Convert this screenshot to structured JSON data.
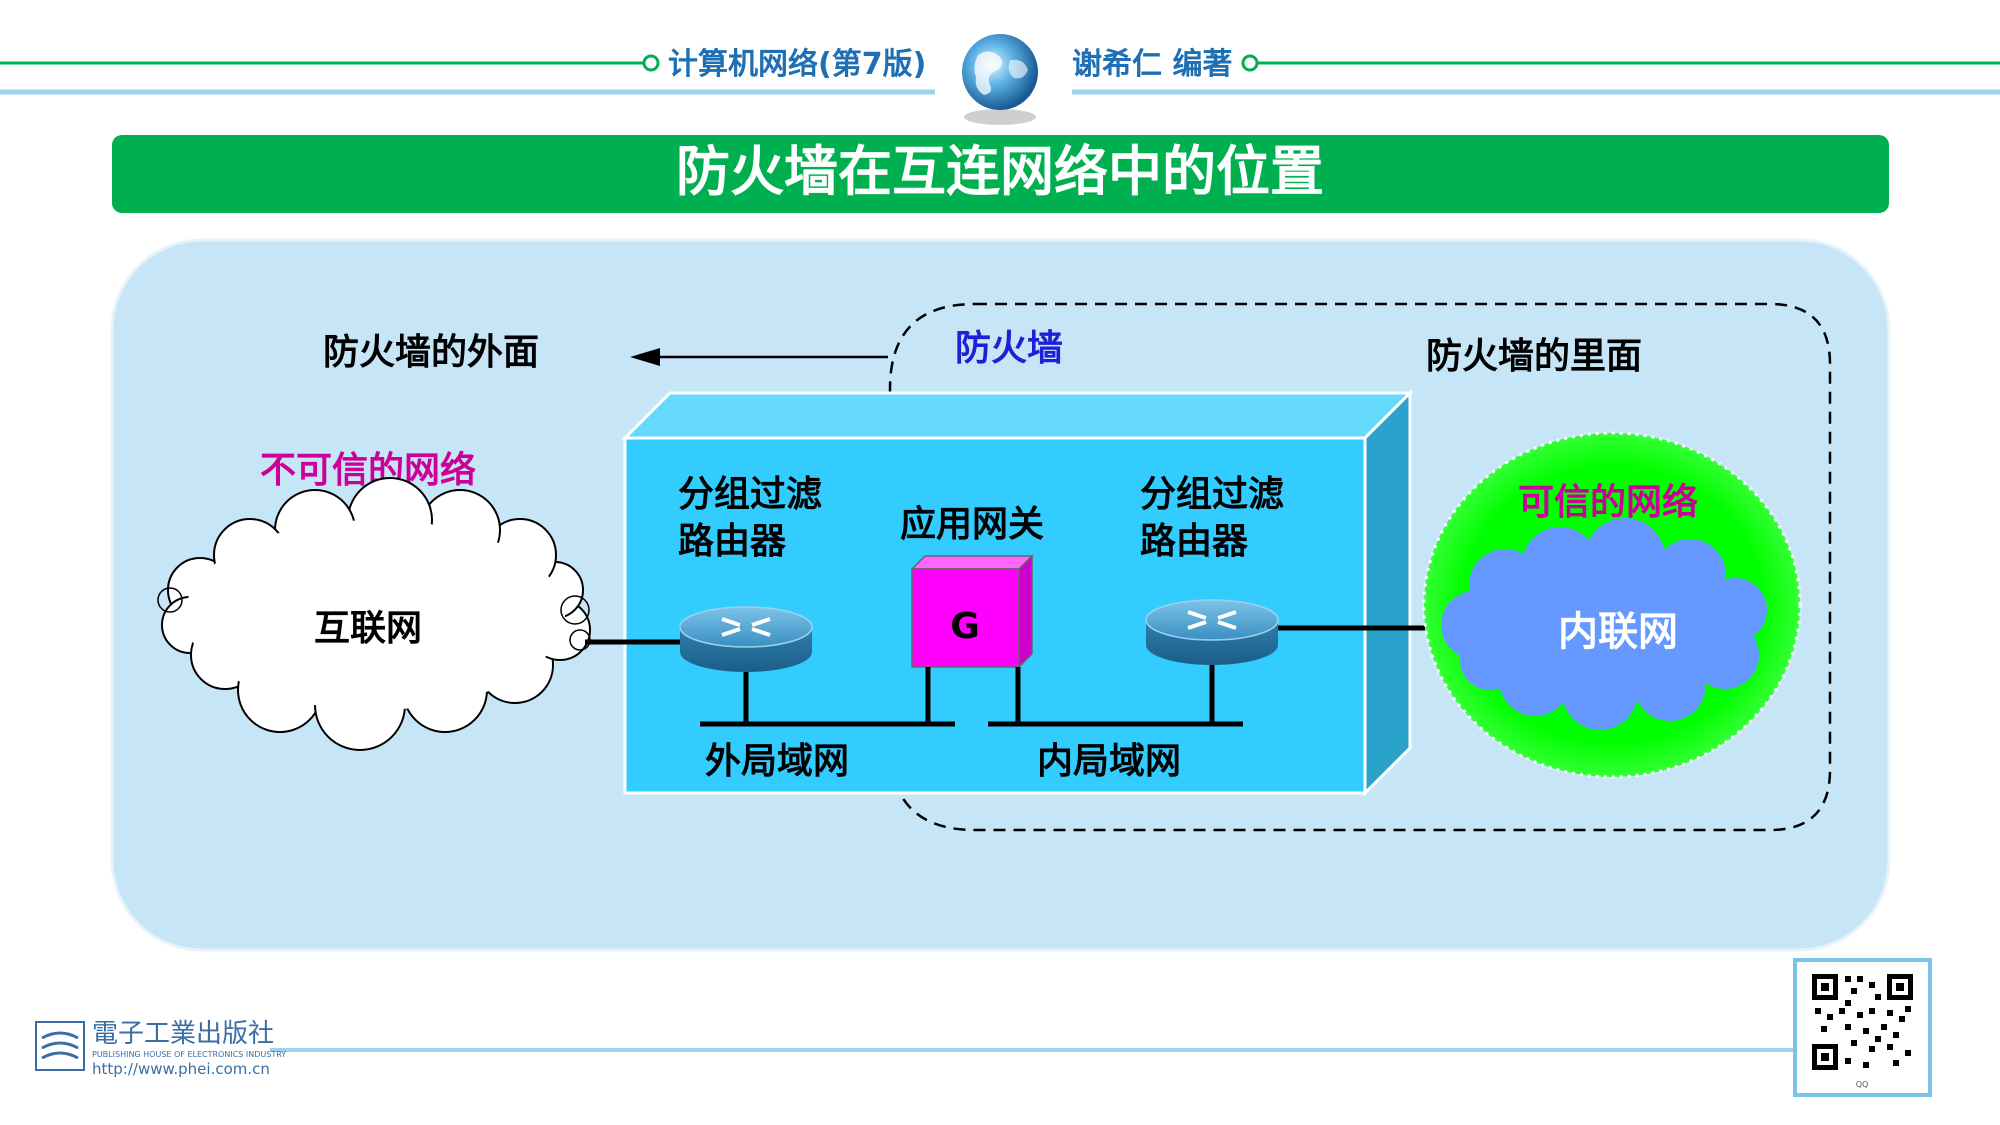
{
  "header": {
    "book_title": "计算机网络(第7版)",
    "author": "谢希仁 编著"
  },
  "slide": {
    "title": "防火墙在互连网络中的位置"
  },
  "diagram": {
    "outside_label": "防火墙的外面",
    "firewall_label": "防火墙",
    "inside_label": "防火墙的里面",
    "untrusted_label": "不可信的网络",
    "trusted_label": "可信的网络",
    "internet_label": "互联网",
    "intranet_label": "内联网",
    "router_left_label_line1": "分组过滤",
    "router_left_label_line2": "路由器",
    "gateway_label": "应用网关",
    "gateway_letter": "G",
    "router_right_label_line1": "分组过滤",
    "router_right_label_line2": "路由器",
    "outer_lan_label": "外局域网",
    "inner_lan_label": "内局域网"
  },
  "footer": {
    "publisher_name": "電子工業出版社",
    "publisher_en": "PUBLISHING HOUSE OF ELECTRONICS INDUSTRY",
    "publisher_url": "http://www.phei.com.cn",
    "qr_caption": "QQ"
  },
  "colors": {
    "header_line": "#00b050",
    "header_line_light": "#9dd3f0",
    "title_bar": "#00b050",
    "panel_bg": "#c6e5f7",
    "firewall_box_front": "#33ccff",
    "firewall_box_top": "#66d9ff",
    "firewall_box_side": "#29a3cc",
    "trusted_zone": "#00ff00",
    "intranet_cloud": "#6699ff",
    "gateway": "#ff00ff",
    "untrusted_text": "#cc0099",
    "firewall_text": "#1f1fd6",
    "router_body": "#3d8bb3"
  }
}
